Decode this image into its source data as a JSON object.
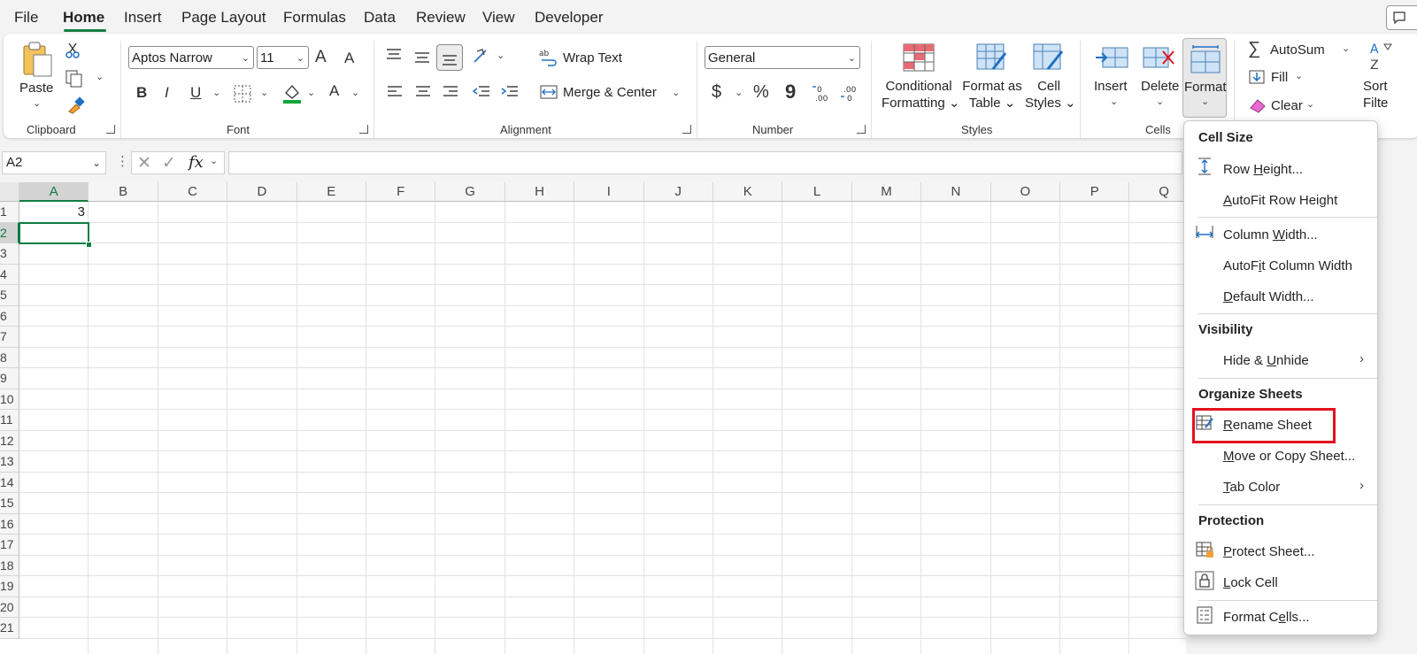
{
  "menubar": {
    "tabs": [
      "File",
      "Home",
      "Insert",
      "Page Layout",
      "Formulas",
      "Data",
      "Review",
      "View",
      "Developer"
    ],
    "active": "Home"
  },
  "ribbon": {
    "clipboard": {
      "label": "Clipboard",
      "paste": "Paste"
    },
    "font": {
      "label": "Font",
      "family": "Aptos Narrow",
      "size": "11",
      "bold": "B",
      "italic": "I",
      "underline": "U",
      "font_color": "A",
      "grow": "A",
      "shrink": "A"
    },
    "alignment": {
      "label": "Alignment",
      "wrap_text": "Wrap Text",
      "merge_center": "Merge & Center"
    },
    "number": {
      "label": "Number",
      "format": "General",
      "currency": "$",
      "percent": "%",
      "comma": "9"
    },
    "styles": {
      "label": "Styles",
      "conditional_l1": "Conditional",
      "conditional_l2": "Formatting",
      "format_table_l1": "Format as",
      "format_table_l2": "Table",
      "cell_styles_l1": "Cell",
      "cell_styles_l2": "Styles"
    },
    "cells": {
      "label": "Cells",
      "insert": "Insert",
      "delete": "Delete",
      "format": "Format"
    },
    "editing": {
      "autosum": "AutoSum",
      "fill": "Fill",
      "clear": "Clear",
      "sort_l1": "Sort",
      "sort_l2": "Filte"
    }
  },
  "formula_bar": {
    "name_box": "A2",
    "fx": "fx",
    "value": ""
  },
  "grid": {
    "columns": [
      "A",
      "B",
      "C",
      "D",
      "E",
      "F",
      "G",
      "H",
      "I",
      "J",
      "K",
      "L",
      "M",
      "N",
      "O",
      "P",
      "Q"
    ],
    "rows": [
      "1",
      "2",
      "3",
      "4",
      "5",
      "6",
      "7",
      "8",
      "9",
      "10",
      "11",
      "12",
      "13",
      "14",
      "15",
      "16",
      "17",
      "18",
      "19",
      "20",
      "21"
    ],
    "selected_col": "A",
    "selected_row": "2",
    "cell_A1": "3"
  },
  "format_menu": {
    "cell_size": "Cell Size",
    "row_height_pre": "Row ",
    "row_height_u": "H",
    "row_height_post": "eight...",
    "autofit_row_u": "A",
    "autofit_row_post": "utoFit Row Height",
    "column_width_pre": "Column ",
    "column_width_u": "W",
    "column_width_post": "idth...",
    "autofit_col_pre": "AutoF",
    "autofit_col_u": "i",
    "autofit_col_post": "t Column Width",
    "default_width_u": "D",
    "default_width_post": "efault Width...",
    "visibility": "Visibility",
    "hide_unhide_pre": "Hide & ",
    "hide_unhide_u": "U",
    "hide_unhide_post": "nhide",
    "organize": "Organize Sheets",
    "rename_u": "R",
    "rename_post": "ename Sheet",
    "move_copy_u": "M",
    "move_copy_post": "ove or Copy Sheet...",
    "tab_color_u": "T",
    "tab_color_post": "ab Color",
    "protection": "Protection",
    "protect_u": "P",
    "protect_post": "rotect Sheet...",
    "lock_u": "L",
    "lock_post": "ock Cell",
    "format_cells_pre": "Format C",
    "format_cells_u": "e",
    "format_cells_post": "lls..."
  },
  "colors": {
    "accent": "#107c41",
    "highlight": "#e3121e"
  }
}
